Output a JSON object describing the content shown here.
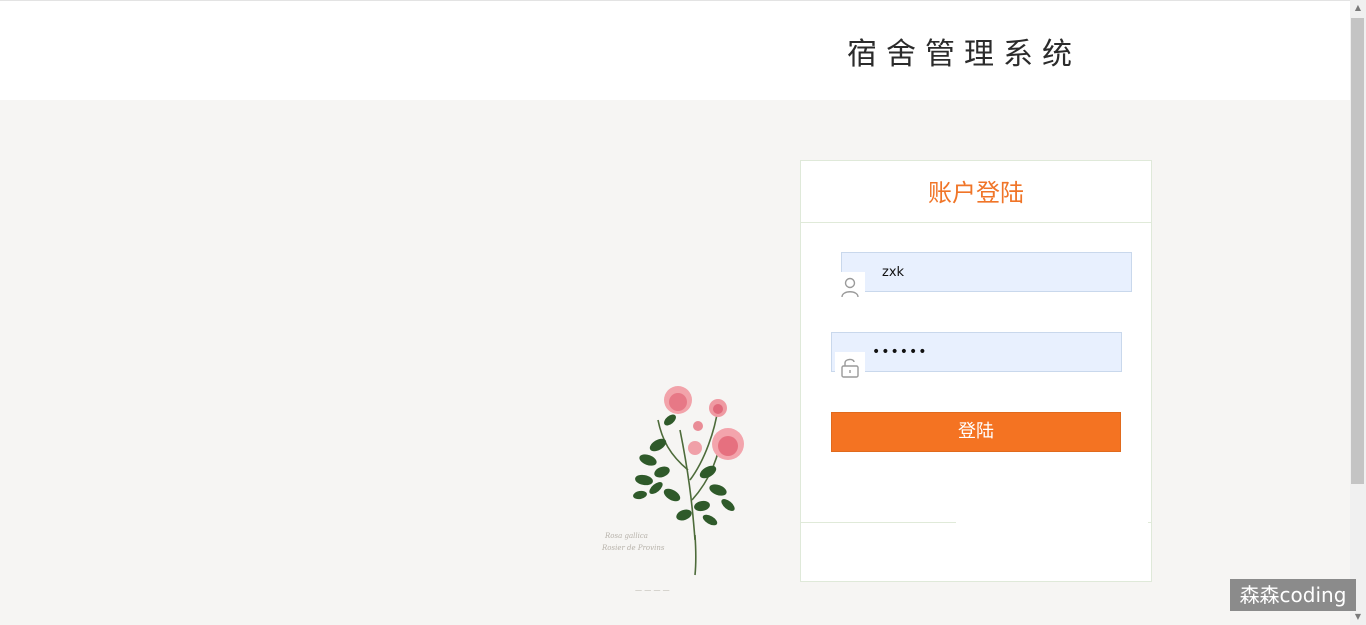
{
  "header": {
    "title": "宿舍管理系统"
  },
  "login": {
    "title": "账户登陆",
    "username_value": "zxk",
    "password_value": "123456",
    "submit_label": "登陆"
  },
  "icons": {
    "username": "user-icon",
    "password": "lock-icon"
  },
  "colors": {
    "accent": "#f47322",
    "title_color": "#f07528",
    "input_bg": "#e8f0fe"
  },
  "watermark": "森森coding"
}
